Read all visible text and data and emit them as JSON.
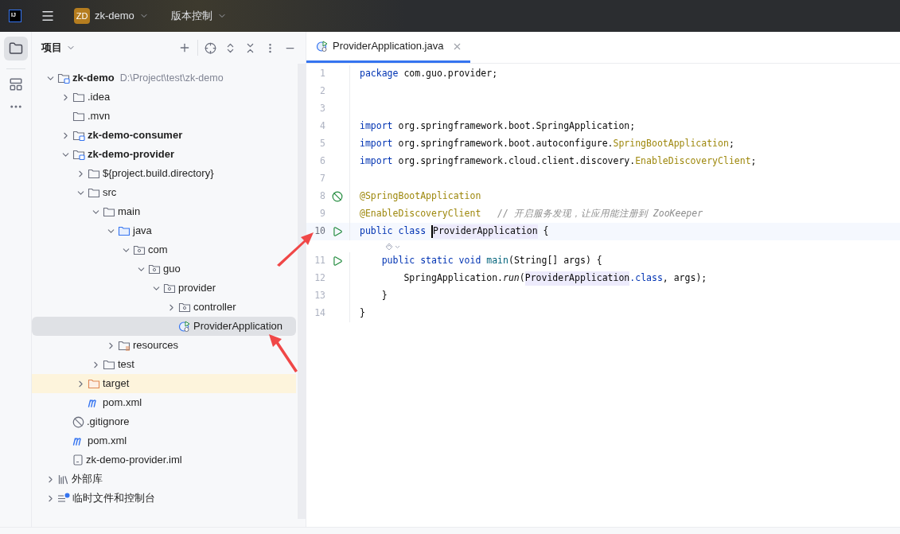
{
  "title_bar": {
    "logo": "IJ",
    "project_badge": "ZD",
    "project": "zk-demo",
    "vcs": "版本控制"
  },
  "project_panel": {
    "title": "项目",
    "tree": [
      {
        "label": "zk-demo",
        "hint": "D:\\Project\\test\\zk-demo",
        "kind": "module",
        "bold": true,
        "expanded": true,
        "selected": false,
        "children": [
          {
            "label": ".idea",
            "kind": "folder",
            "expanded": false,
            "selected": false
          },
          {
            "label": ".mvn",
            "kind": "folder",
            "selected": false
          },
          {
            "label": "zk-demo-consumer",
            "kind": "module",
            "bold": true,
            "expanded": false,
            "selected": false
          },
          {
            "label": "zk-demo-provider",
            "kind": "module",
            "bold": true,
            "expanded": true,
            "selected": false,
            "children": [
              {
                "label": "${project.build.directory}",
                "kind": "folder",
                "expanded": false,
                "selected": false
              },
              {
                "label": "src",
                "kind": "folder",
                "expanded": true,
                "selected": false,
                "children": [
                  {
                    "label": "main",
                    "kind": "folder",
                    "expanded": true,
                    "selected": false,
                    "children": [
                      {
                        "label": "java",
                        "kind": "source-folder",
                        "expanded": true,
                        "selected": false,
                        "children": [
                          {
                            "label": "com",
                            "kind": "package",
                            "expanded": true,
                            "selected": false,
                            "children": [
                              {
                                "label": "guo",
                                "kind": "package",
                                "expanded": true,
                                "selected": false,
                                "children": [
                                  {
                                    "label": "provider",
                                    "kind": "package",
                                    "expanded": true,
                                    "selected": false,
                                    "children": [
                                      {
                                        "label": "controller",
                                        "kind": "package",
                                        "expanded": false,
                                        "selected": false
                                      },
                                      {
                                        "label": "ProviderApplication",
                                        "kind": "spring-class",
                                        "selected": true
                                      }
                                    ]
                                  }
                                ]
                              }
                            ]
                          }
                        ]
                      },
                      {
                        "label": "resources",
                        "kind": "resources-folder",
                        "expanded": false,
                        "selected": false
                      }
                    ]
                  },
                  {
                    "label": "test",
                    "kind": "folder",
                    "expanded": false,
                    "selected": false
                  }
                ]
              },
              {
                "label": "target",
                "kind": "excluded-folder",
                "expanded": false,
                "selected": false
              },
              {
                "label": "pom.xml",
                "kind": "maven",
                "selected": false
              }
            ]
          },
          {
            "label": ".gitignore",
            "kind": "ignore",
            "selected": false
          },
          {
            "label": "pom.xml",
            "kind": "maven",
            "selected": false
          },
          {
            "label": "zk-demo-provider.iml",
            "kind": "iml",
            "selected": false
          }
        ]
      },
      {
        "label": "外部库",
        "kind": "library",
        "expanded": false,
        "selected": false
      },
      {
        "label": "临时文件和控制台",
        "kind": "scratch",
        "expanded": false,
        "selected": false
      }
    ]
  },
  "editor": {
    "tabs": [
      {
        "label": "ProviderApplication.java",
        "selected": true
      }
    ],
    "lines": [
      {
        "kind": "code",
        "number": "1",
        "tokens": [
          {
            "text": "package",
            "kind": "keyword"
          },
          {
            "text": " com.guo.provider;",
            "kind": "plain"
          }
        ]
      },
      {
        "kind": "code",
        "number": "2"
      },
      {
        "kind": "code",
        "number": "3"
      },
      {
        "kind": "code",
        "number": "4",
        "tokens": [
          {
            "text": "import",
            "kind": "keyword"
          },
          {
            "text": " org.springframework.boot.SpringApplication;",
            "kind": "plain"
          }
        ]
      },
      {
        "kind": "code",
        "number": "5",
        "tokens": [
          {
            "text": "import",
            "kind": "keyword"
          },
          {
            "text": " org.springframework.boot.autoconfigure.",
            "kind": "plain"
          },
          {
            "text": "SpringBootApplication",
            "kind": "annotation"
          },
          {
            "text": ";",
            "kind": "plain"
          }
        ]
      },
      {
        "kind": "code",
        "number": "6",
        "tokens": [
          {
            "text": "import",
            "kind": "keyword"
          },
          {
            "text": " org.springframework.cloud.client.discovery.",
            "kind": "plain"
          },
          {
            "text": "EnableDiscoveryClient",
            "kind": "annotation"
          },
          {
            "text": ";",
            "kind": "plain"
          }
        ]
      },
      {
        "kind": "code",
        "number": "7"
      },
      {
        "kind": "code",
        "number": "8",
        "marker": {
          "kind": "bean"
        },
        "tokens": [
          {
            "text": "@SpringBootApplication",
            "kind": "annotation"
          }
        ]
      },
      {
        "kind": "code",
        "number": "9",
        "tokens": [
          {
            "text": "@EnableDiscoveryClient",
            "kind": "annotation"
          },
          {
            "text": "   // 开启服务发现，让应用能注册到 ZooKeeper",
            "kind": "comment"
          }
        ]
      },
      {
        "kind": "code",
        "number": "10",
        "marker": {
          "kind": "run"
        },
        "current": true,
        "tokens": [
          {
            "text": "public class ",
            "kind": "keyword"
          },
          {
            "text": "ProviderApplication",
            "kind": "ref",
            "caret": true
          },
          {
            "text": " {",
            "kind": "plain"
          }
        ]
      },
      {
        "kind": "hint"
      },
      {
        "kind": "code",
        "number": "11",
        "marker": {
          "kind": "run"
        },
        "tokens": [
          {
            "text": "    public static void ",
            "kind": "keyword"
          },
          {
            "text": "main",
            "kind": "method"
          },
          {
            "text": "(String[] args) {",
            "kind": "plain"
          }
        ]
      },
      {
        "kind": "code",
        "number": "12",
        "tokens": [
          {
            "text": "        SpringApplication.",
            "kind": "plain"
          },
          {
            "text": "run",
            "kind": "static-call"
          },
          {
            "text": "(",
            "kind": "plain"
          },
          {
            "text": "ProviderApplication",
            "kind": "ref"
          },
          {
            "text": ".class",
            "kind": "keyword"
          },
          {
            "text": ", args);",
            "kind": "plain"
          }
        ]
      },
      {
        "kind": "code",
        "number": "13",
        "tokens": [
          {
            "text": "    }",
            "kind": "plain"
          }
        ]
      },
      {
        "kind": "code",
        "number": "14",
        "tokens": [
          {
            "text": "}",
            "kind": "plain"
          }
        ]
      }
    ]
  }
}
